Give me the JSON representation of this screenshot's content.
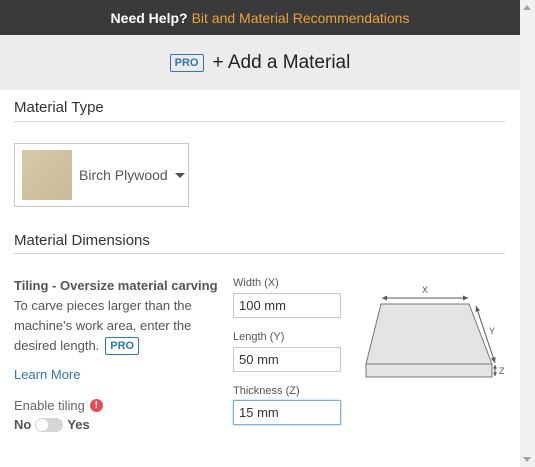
{
  "help_bar": {
    "question": "Need Help?",
    "link": "Bit and Material Recommendations"
  },
  "header": {
    "badge": "PRO",
    "title": "+ Add a Material"
  },
  "material_type": {
    "section_title": "Material Type",
    "selected": "Birch Plywood"
  },
  "dimensions": {
    "section_title": "Material Dimensions",
    "tiling": {
      "title": "Tiling - Oversize material carving",
      "description": "To carve pieces larger than the machine's work area, enter the desired length.",
      "badge": "PRO",
      "learn_more": "Learn More",
      "enable_label": "Enable tiling",
      "warn_glyph": "!",
      "toggle_off": "No",
      "toggle_on": "Yes",
      "enabled": false
    },
    "fields": {
      "width": {
        "label": "Width (X)",
        "value": "100 mm"
      },
      "length": {
        "label": "Length (Y)",
        "value": "50 mm"
      },
      "thickness": {
        "label": "Thickness (Z)",
        "value": "15 mm"
      }
    },
    "diagram": {
      "x": "X",
      "y": "Y",
      "z": "Z"
    }
  },
  "colors": {
    "accent_link": "#e9a33a",
    "pro_blue": "#2f76b5",
    "warning": "#e05050"
  }
}
